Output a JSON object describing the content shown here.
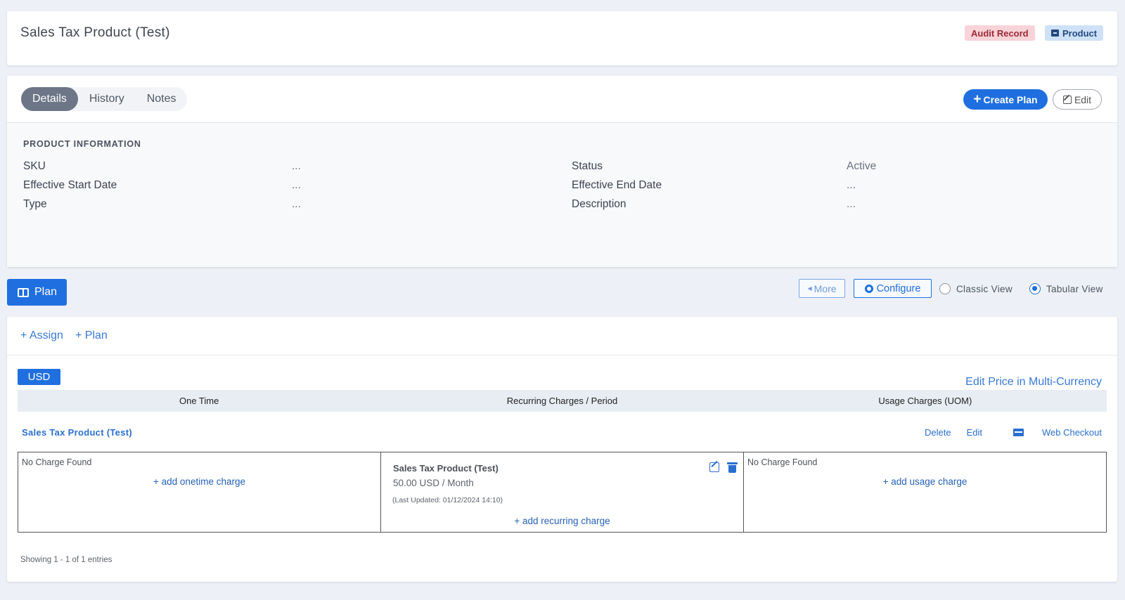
{
  "header": {
    "title": "Sales Tax Product (Test)",
    "badges": {
      "audit": "Audit Record",
      "product": "Product"
    }
  },
  "details": {
    "tabs": [
      "Details",
      "History",
      "Notes"
    ],
    "active_tab": "Details",
    "create_plan_label": "Create Plan",
    "edit_label": "Edit",
    "section_title": "PRODUCT INFORMATION",
    "left_fields": [
      {
        "label": "SKU",
        "value": "..."
      },
      {
        "label": "Effective Start Date",
        "value": "..."
      },
      {
        "label": "Type",
        "value": "..."
      }
    ],
    "right_fields": [
      {
        "label": "Status",
        "value": "Active"
      },
      {
        "label": "Effective End Date",
        "value": "..."
      },
      {
        "label": "Description",
        "value": "..."
      }
    ]
  },
  "toolbar": {
    "plan_label": "Plan",
    "more_label": "More",
    "configure_label": "Configure",
    "classic_view_label": "Classic View",
    "tabular_view_label": "Tabular View",
    "selected_view": "Tabular View"
  },
  "plan": {
    "assign_label": "+ Assign",
    "plan_link_label": "+ Plan",
    "currency": "USD",
    "multi_currency_label": "Edit Price in Multi-Currency",
    "columns": [
      "One Time",
      "Recurring Charges / Period",
      "Usage Charges (UOM)"
    ],
    "product_name": "Sales Tax Product (Test)",
    "actions": {
      "delete": "Delete",
      "edit": "Edit",
      "web_checkout": "Web Checkout"
    },
    "onetime": {
      "empty": "No Charge Found",
      "add": "+ add onetime charge"
    },
    "recurring": {
      "title": "Sales Tax Product (Test)",
      "price": "50.00 USD / Month",
      "updated": "(Last Updated: 01/12/2024 14:10)",
      "add": "+ add recurring charge"
    },
    "usage": {
      "empty": "No Charge Found",
      "add": "+ add usage charge"
    },
    "showing": "Showing 1 - 1 of 1 entries"
  },
  "colors": {
    "primary": "#1f6fe0",
    "link": "#3779d9",
    "audit_bg": "#f8d3d8",
    "product_bg": "#cfe1f7"
  }
}
